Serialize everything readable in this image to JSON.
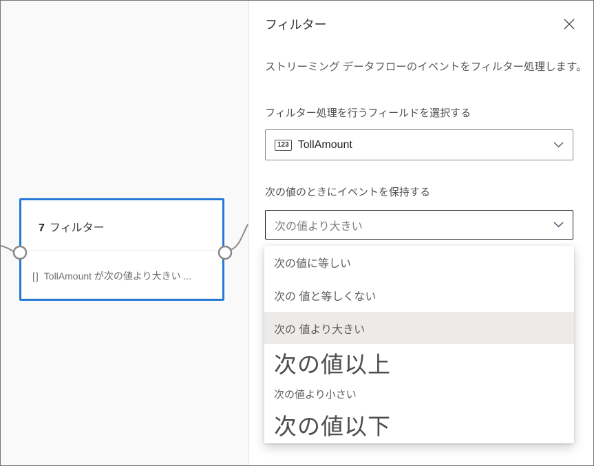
{
  "canvas": {
    "node": {
      "number": "7",
      "title": "フィルター",
      "type_badge": "[]",
      "summary": "TollAmount が次の値より大きい ..."
    }
  },
  "panel": {
    "title": "フィルター",
    "description": "ストリーミング データフローのイベントをフィルター処理します。",
    "field_picker": {
      "label": "フィルター処理を行うフィールドを選択する",
      "type_icon": "123",
      "value": "TollAmount"
    },
    "operator_picker": {
      "label": "次の値のときにイベントを保持する",
      "value": "次の値より大きい"
    },
    "operator_options": [
      {
        "label": "次の値に等しい",
        "selected": false
      },
      {
        "label": "次の 値と等しくない",
        "selected": false
      },
      {
        "label": "次の 値より大きい",
        "selected": true
      },
      {
        "label": "次の値以上",
        "selected": false
      },
      {
        "label": "次の値より小さい",
        "selected": false
      },
      {
        "label": "次の値以下",
        "selected": false
      }
    ]
  },
  "colors": {
    "node_border": "#2479d5",
    "selected_option_bg": "#edebe9",
    "connector_stroke": "#8a8886",
    "panel_divider": "#e4e2e0"
  }
}
